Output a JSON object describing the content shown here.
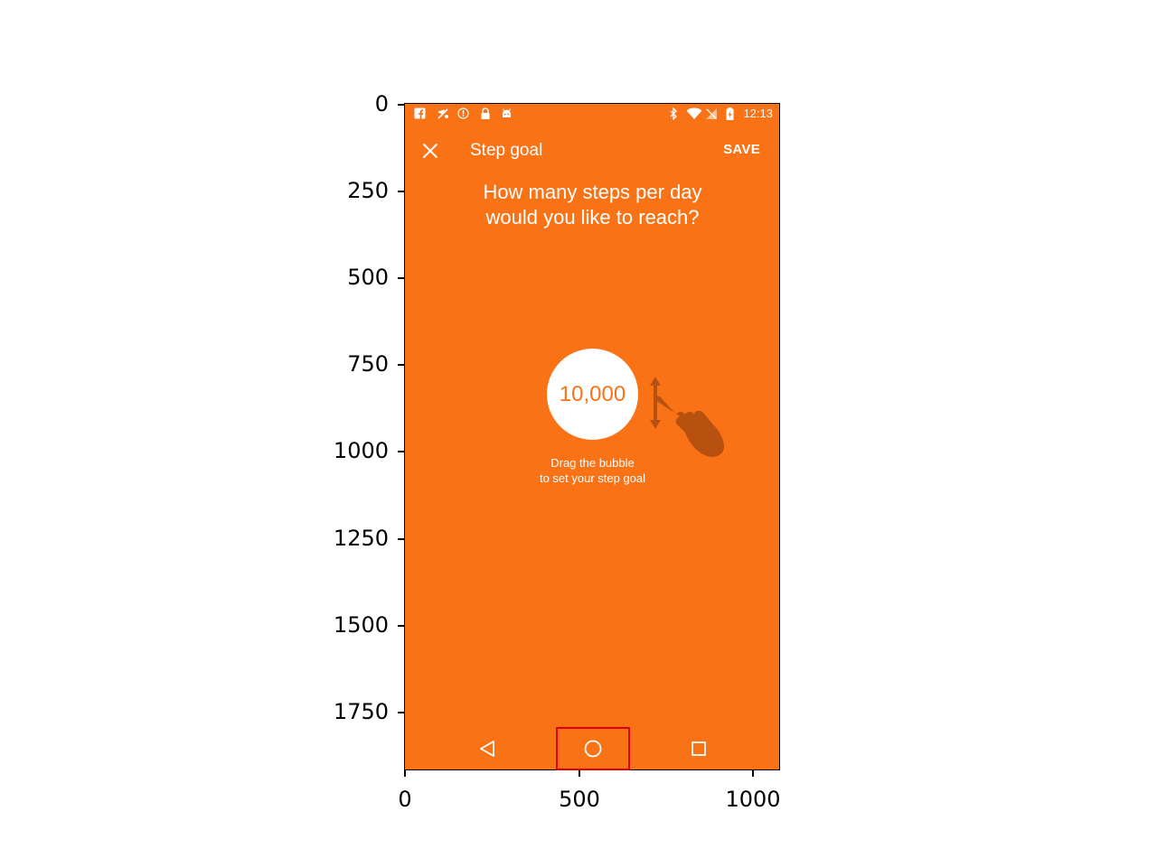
{
  "status_bar": {
    "left_icons": [
      "facebook-icon",
      "no-location-icon",
      "info-icon",
      "lock-icon",
      "android-icon"
    ],
    "right_icons": [
      "bluetooth-icon",
      "wifi-icon",
      "no-signal-icon",
      "battery-charging-icon"
    ],
    "time": "12:13"
  },
  "toolbar": {
    "close_icon": "close-icon",
    "title": "Step goal",
    "save_label": "SAVE"
  },
  "question": {
    "line1": "How many steps per day",
    "line2": "would you like to reach?"
  },
  "bubble": {
    "value": "10,000"
  },
  "hint": {
    "line1": "Drag the bubble",
    "line2": "to set your step goal"
  },
  "nav_bar": {
    "buttons": [
      "back-icon",
      "home-icon",
      "recents-icon"
    ]
  },
  "axes": {
    "y_ticks": [
      "0",
      "250",
      "500",
      "750",
      "1000",
      "1250",
      "1500",
      "1750"
    ],
    "x_ticks": [
      "0",
      "500",
      "1000"
    ]
  },
  "colors": {
    "background": "#f97316",
    "bubble": "#ffffff",
    "bubble_text": "#f97316",
    "hand": "#b8500f",
    "highlight": "#e00000"
  }
}
